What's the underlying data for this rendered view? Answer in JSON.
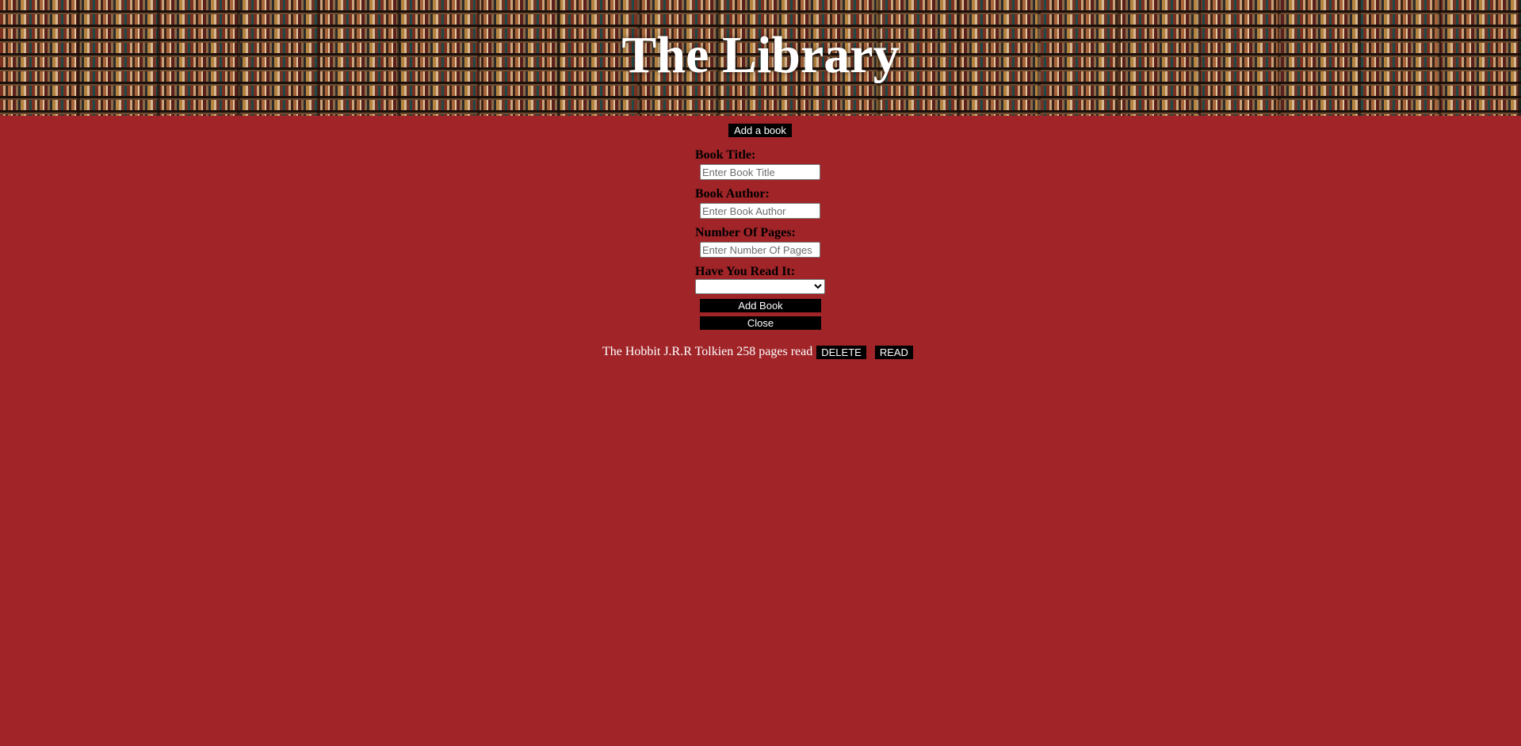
{
  "header": {
    "title": "The Library"
  },
  "toolbar": {
    "add_a_book_label": "Add a book"
  },
  "form": {
    "title_label": "Book Title:",
    "title_placeholder": "Enter Book Title",
    "author_label": "Book Author:",
    "author_placeholder": "Enter Book Author",
    "pages_label": "Number Of Pages:",
    "pages_placeholder": "Enter Number Of Pages",
    "read_label": "Have You Read It:",
    "read_selected": "",
    "add_book_label": "Add Book",
    "close_label": "Close"
  },
  "books": [
    {
      "title": "The Hobbit",
      "author": "J.R.R Tolkien",
      "pages": "258 pages",
      "status": "read",
      "delete_label": "DELETE",
      "read_label": "READ"
    }
  ],
  "colors": {
    "background": "#a02428",
    "button": "#000000",
    "button_text": "#ffffff",
    "title_text": "#ffffff"
  }
}
